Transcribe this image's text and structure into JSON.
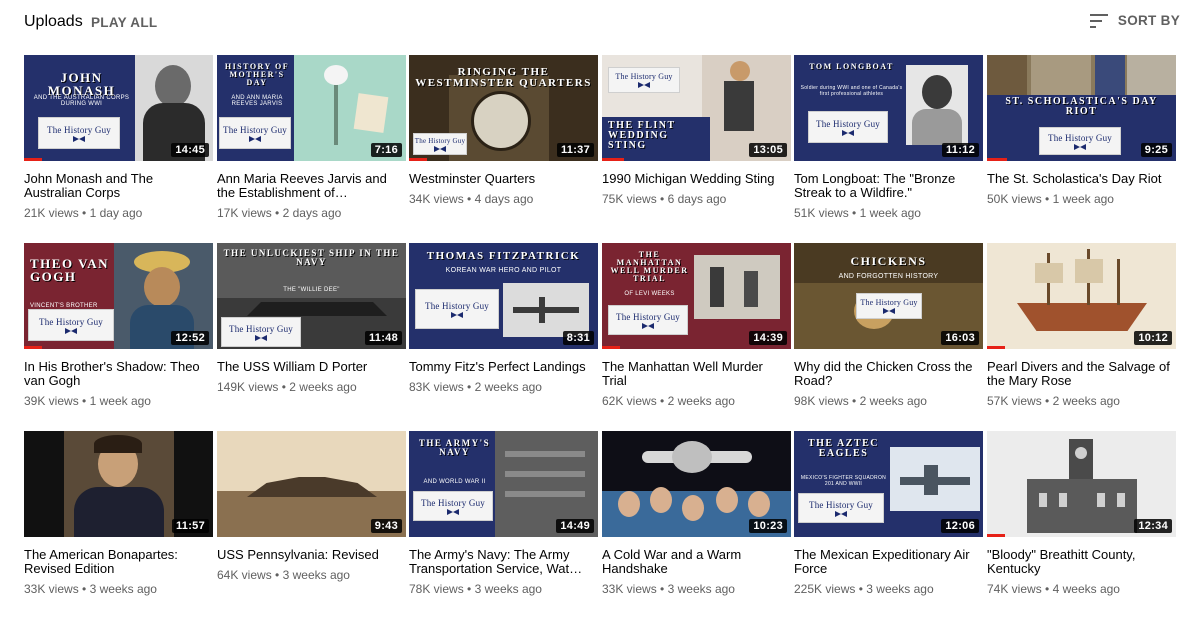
{
  "header": {
    "title": "Uploads",
    "play_all": "PLAY ALL",
    "sort_by": "SORT BY"
  },
  "videos": [
    {
      "title": "John Monash and The Australian Corps",
      "views": "21K views",
      "age": "1 day ago",
      "duration": "14:45",
      "thumb_text": "JOHN MONASH",
      "thumb_sub": "AND THE AUSTRALIAN CORPS DURING WWI",
      "logo": "The History Guy",
      "watched_fraction": 0.1
    },
    {
      "title": "Ann Maria Reeves Jarvis and the Establishment of…",
      "views": "17K views",
      "age": "2 days ago",
      "duration": "7:16",
      "thumb_text": "HISTORY OF MOTHER'S DAY",
      "thumb_sub": "AND ANN MARIA REEVES JARVIS",
      "logo": "The History Guy",
      "watched_fraction": 0
    },
    {
      "title": "Westminster Quarters",
      "views": "34K views",
      "age": "4 days ago",
      "duration": "11:37",
      "thumb_text": "RINGING THE WESTMINSTER QUARTERS",
      "thumb_sub": "",
      "logo": "The History Guy",
      "watched_fraction": 0.1
    },
    {
      "title": "1990 Michigan Wedding Sting",
      "views": "75K views",
      "age": "6 days ago",
      "duration": "13:05",
      "thumb_text": "THE FLINT WEDDING STING",
      "thumb_sub": "",
      "logo": "The History Guy",
      "watched_fraction": 0.1
    },
    {
      "title": "Tom Longboat: The \"Bronze Streak to a Wildfire.\"",
      "views": "51K views",
      "age": "1 week ago",
      "duration": "11:12",
      "thumb_text": "TOM LONGBOAT",
      "thumb_sub": "Soldier during WWI and one of Canada's first professional athletes",
      "logo": "The History Guy",
      "watched_fraction": 0
    },
    {
      "title": "The St. Scholastica's Day Riot",
      "views": "50K views",
      "age": "1 week ago",
      "duration": "9:25",
      "thumb_text": "ST. SCHOLASTICA'S DAY RIOT",
      "thumb_sub": "",
      "logo": "The History Guy",
      "watched_fraction": 0.1
    },
    {
      "title": "In His Brother's Shadow: Theo van Gogh",
      "views": "39K views",
      "age": "1 week ago",
      "duration": "12:52",
      "thumb_text": "THEO VAN GOGH",
      "thumb_sub": "VINCENT'S BROTHER",
      "logo": "The History Guy",
      "watched_fraction": 0.1
    },
    {
      "title": "The USS William D Porter",
      "views": "149K views",
      "age": "2 weeks ago",
      "duration": "11:48",
      "thumb_text": "THE UNLUCKIEST SHIP IN THE NAVY",
      "thumb_sub": "THE \"WILLIE DEE\"",
      "logo": "The History Guy",
      "watched_fraction": 0
    },
    {
      "title": "Tommy Fitz's Perfect Landings",
      "views": "83K views",
      "age": "2 weeks ago",
      "duration": "8:31",
      "thumb_text": "THOMAS FITZPATRICK",
      "thumb_sub": "KOREAN WAR HERO AND PILOT",
      "logo": "The History Guy",
      "watched_fraction": 0
    },
    {
      "title": "The Manhattan Well Murder Trial",
      "views": "62K views",
      "age": "2 weeks ago",
      "duration": "14:39",
      "thumb_text": "THE MANHATTAN WELL MURDER TRIAL",
      "thumb_sub": "OF LEVI WEEKS",
      "logo": "The History Guy",
      "watched_fraction": 0.1
    },
    {
      "title": "Why did the Chicken Cross the Road?",
      "views": "98K views",
      "age": "2 weeks ago",
      "duration": "16:03",
      "thumb_text": "CHICKENS",
      "thumb_sub": "AND FORGOTTEN HISTORY",
      "logo": "The History Guy",
      "watched_fraction": 0
    },
    {
      "title": "Pearl Divers and the Salvage of the Mary Rose",
      "views": "57K views",
      "age": "2 weeks ago",
      "duration": "10:12",
      "thumb_text": "",
      "thumb_sub": "",
      "logo": "",
      "watched_fraction": 0.1
    },
    {
      "title": "The American Bonapartes: Revised Edition",
      "views": "33K views",
      "age": "3 weeks ago",
      "duration": "11:57",
      "thumb_text": "",
      "thumb_sub": "",
      "logo": "",
      "watched_fraction": 0
    },
    {
      "title": "USS Pennsylvania: Revised",
      "views": "64K views",
      "age": "3 weeks ago",
      "duration": "9:43",
      "thumb_text": "",
      "thumb_sub": "",
      "logo": "",
      "watched_fraction": 0
    },
    {
      "title": "The Army's Navy: The Army Transportation Service, Wat…",
      "views": "78K views",
      "age": "3 weeks ago",
      "duration": "14:49",
      "thumb_text": "THE ARMY'S NAVY",
      "thumb_sub": "AND WORLD WAR II",
      "logo": "The History Guy",
      "watched_fraction": 0
    },
    {
      "title": "A Cold War and a Warm Handshake",
      "views": "33K views",
      "age": "3 weeks ago",
      "duration": "10:23",
      "thumb_text": "",
      "thumb_sub": "",
      "logo": "",
      "watched_fraction": 0
    },
    {
      "title": "The Mexican Expeditionary Air Force",
      "views": "225K views",
      "age": "3 weeks ago",
      "duration": "12:06",
      "thumb_text": "THE AZTEC EAGLES",
      "thumb_sub": "MEXICO'S FIGHTER SQUADRON 201 AND WWII",
      "logo": "The History Guy",
      "watched_fraction": 0
    },
    {
      "title": "\"Bloody\" Breathitt County, Kentucky",
      "views": "74K views",
      "age": "4 weeks ago",
      "duration": "12:34",
      "thumb_text": "",
      "thumb_sub": "",
      "logo": "",
      "watched_fraction": 0.1
    }
  ],
  "separator": "•",
  "colors": {
    "accent": "#e62117",
    "navy": "#24306b",
    "maroon": "#7a2431",
    "text_secondary": "#606060"
  }
}
